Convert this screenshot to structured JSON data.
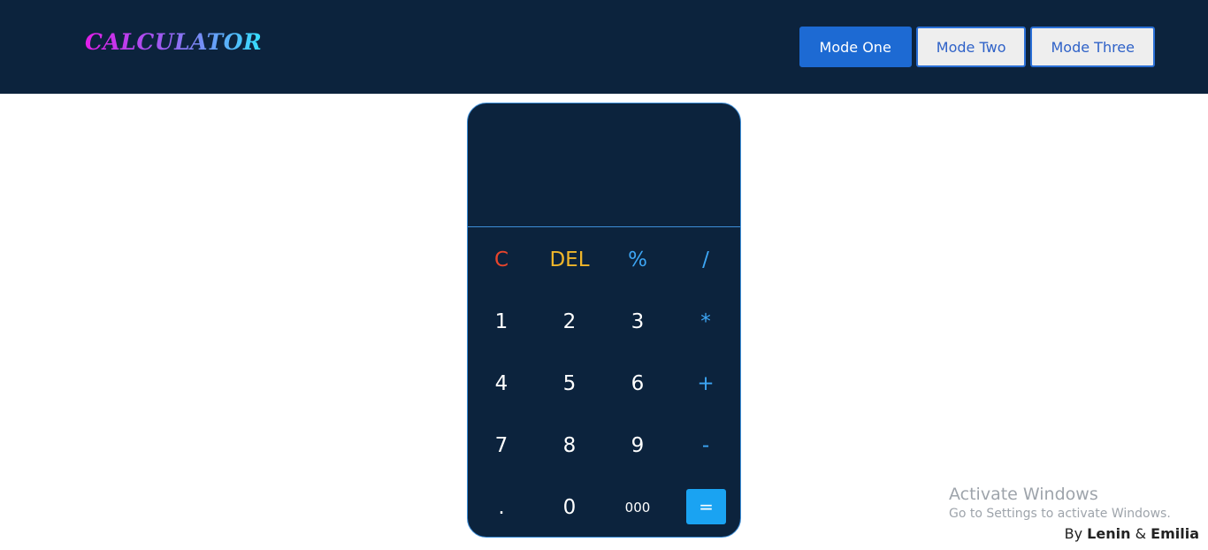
{
  "header": {
    "logo": "CALCULATOR",
    "modes": [
      {
        "label": "Mode One",
        "active": true
      },
      {
        "label": "Mode Two",
        "active": false
      },
      {
        "label": "Mode Three",
        "active": false
      }
    ]
  },
  "calculator": {
    "display": "",
    "keys": {
      "clear": "C",
      "delete": "DEL",
      "percent": "%",
      "divide": "/",
      "one": "1",
      "two": "2",
      "three": "3",
      "multiply": "*",
      "four": "4",
      "five": "5",
      "six": "6",
      "plus": "+",
      "seven": "7",
      "eight": "8",
      "nine": "9",
      "minus": "-",
      "dot": ".",
      "zero": "0",
      "triple_zero": "000",
      "equals": "="
    }
  },
  "watermark": {
    "title": "Activate Windows",
    "subtitle": "Go to Settings to activate Windows."
  },
  "credit": {
    "by": "By",
    "name1": "Lenin",
    "amp": "&",
    "name2": "Emilia"
  },
  "colors": {
    "background_dark": "#0c233d",
    "accent_blue": "#1d6ad3",
    "key_red": "#e8452c",
    "key_yellow": "#f0b62a",
    "key_blue": "#3da6f5",
    "equals_bg": "#1aa3f2"
  }
}
